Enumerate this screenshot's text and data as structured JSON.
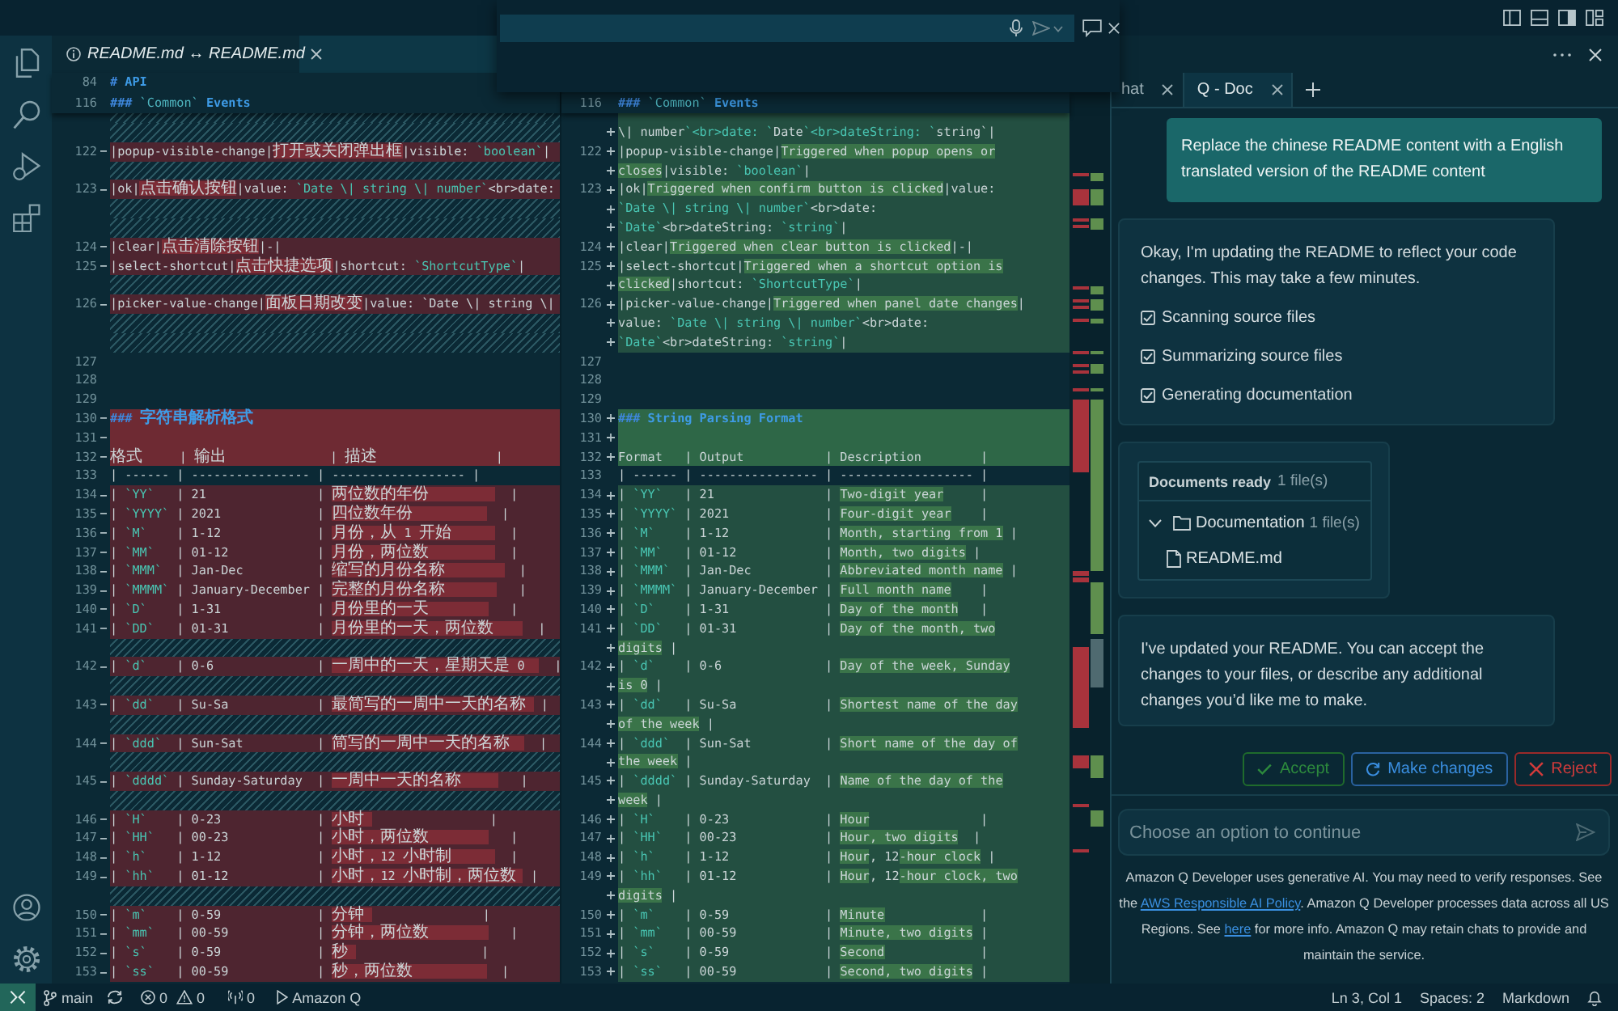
{
  "editor": {
    "tabs": [
      {
        "title": "README.md ↔ README.md",
        "selected": true
      }
    ],
    "left": {
      "sticky": [
        {
          "num": "84",
          "text": "# API"
        },
        {
          "num": "116",
          "text": "### `Common` Events"
        }
      ],
      "rows": [
        {
          "kind": "filler"
        },
        {
          "kind": "removed",
          "num": "122",
          "parts": [
            {
              "text": "|popup-visible-change|",
              "changed": false
            },
            {
              "text": "打开或关闭弹出框",
              "changed": true
            },
            {
              "text": "|visible: `boolean`|",
              "changed": false
            }
          ]
        },
        {
          "kind": "filler"
        },
        {
          "kind": "removed",
          "num": "123",
          "parts": [
            {
              "text": "|ok|",
              "changed": false
            },
            {
              "text": "点击确认按钮",
              "changed": true
            },
            {
              "text": "|value: `Date \\| string \\| number`<br>date:",
              "changed": false
            }
          ]
        },
        {
          "kind": "filler"
        },
        {
          "kind": "filler"
        },
        {
          "kind": "removed",
          "num": "124",
          "parts": [
            {
              "text": "|clear|",
              "changed": false
            },
            {
              "text": "点击清除按钮",
              "changed": true
            },
            {
              "text": "|-|",
              "changed": false
            }
          ]
        },
        {
          "kind": "removed",
          "num": "125",
          "parts": [
            {
              "text": "|select-shortcut|",
              "changed": false
            },
            {
              "text": "点击快捷选项",
              "changed": true
            },
            {
              "text": "|shortcut: `ShortcutType`|",
              "changed": false
            }
          ]
        },
        {
          "kind": "filler"
        },
        {
          "kind": "removed",
          "num": "126",
          "parts": [
            {
              "text": "|picker-value-change|",
              "changed": false
            },
            {
              "text": "面板日期改变",
              "changed": true
            },
            {
              "text": "|value: `Date \\| string \\|",
              "changed": false
            }
          ]
        },
        {
          "kind": "filler"
        },
        {
          "kind": "filler"
        },
        {
          "kind": "context",
          "num": "127"
        },
        {
          "kind": "context",
          "num": "128"
        },
        {
          "kind": "context",
          "num": "129"
        },
        {
          "kind": "removed",
          "num": "130",
          "changed": true,
          "text": "### 字符串解析格式"
        },
        {
          "kind": "removed",
          "num": "131",
          "changed": true
        },
        {
          "kind": "removed",
          "num": "132",
          "changed": true,
          "text": "格式     | 输出              | 描述                |"
        },
        {
          "kind": "context",
          "num": "133",
          "text": "| ------ | ---------------- | ------------------ |"
        },
        {
          "kind": "removed",
          "num": "134",
          "parts": [
            {
              "text": "| `YY`   | 21               | ",
              "changed": false
            },
            {
              "text": "两位数的年份         ",
              "changed": true
            },
            {
              "text": "  |",
              "changed": false
            }
          ]
        },
        {
          "kind": "removed",
          "num": "135",
          "parts": [
            {
              "text": "| `YYYY` | 2021             | ",
              "changed": false
            },
            {
              "text": "四位数年份          ",
              "changed": true
            },
            {
              "text": "  |",
              "changed": false
            }
          ]
        },
        {
          "kind": "removed",
          "num": "136",
          "parts": [
            {
              "text": "| `M`    | 1-12             | ",
              "changed": false
            },
            {
              "text": "月份，从 1 开始      ",
              "changed": true
            },
            {
              "text": "  |",
              "changed": false
            }
          ]
        },
        {
          "kind": "removed",
          "num": "137",
          "parts": [
            {
              "text": "| `MM`   | 01-12            | ",
              "changed": false
            },
            {
              "text": "月份，两位数         ",
              "changed": true
            },
            {
              "text": "  |",
              "changed": false
            }
          ]
        },
        {
          "kind": "removed",
          "num": "138",
          "parts": [
            {
              "text": "| `MMM`  | Jan-Dec          | ",
              "changed": false
            },
            {
              "text": "缩写的月份名称        ",
              "changed": true
            },
            {
              "text": "  |",
              "changed": false
            }
          ]
        },
        {
          "kind": "removed",
          "num": "139",
          "parts": [
            {
              "text": "| `MMMM` | January-December | ",
              "changed": false
            },
            {
              "text": "完整的月份名称       ",
              "changed": true
            },
            {
              "text": "   |",
              "changed": false
            }
          ]
        },
        {
          "kind": "removed",
          "num": "140",
          "parts": [
            {
              "text": "| `D`    | 1-31             | ",
              "changed": false
            },
            {
              "text": "月份里的一天        ",
              "changed": true
            },
            {
              "text": "   |",
              "changed": false
            }
          ]
        },
        {
          "kind": "removed",
          "num": "141",
          "parts": [
            {
              "text": "| `DD`   | 01-31            | ",
              "changed": false
            },
            {
              "text": "月份里的一天，两位数    ",
              "changed": true
            },
            {
              "text": "  |",
              "changed": false
            }
          ]
        },
        {
          "kind": "filler"
        },
        {
          "kind": "removed",
          "num": "142",
          "parts": [
            {
              "text": "| `d`    | 0-6              | ",
              "changed": false
            },
            {
              "text": "一周中的一天，星期天是 0  ",
              "changed": true
            },
            {
              "text": "  |",
              "changed": false
            }
          ]
        },
        {
          "kind": "filler"
        },
        {
          "kind": "removed",
          "num": "143",
          "parts": [
            {
              "text": "| `dd`   | Su-Sa            | ",
              "changed": false
            },
            {
              "text": "最简写的一周中一天的名称 ",
              "changed": true
            },
            {
              "text": " |",
              "changed": false
            }
          ]
        },
        {
          "kind": "filler"
        },
        {
          "kind": "removed",
          "num": "144",
          "parts": [
            {
              "text": "| `ddd`  | Sun-Sat          | ",
              "changed": false
            },
            {
              "text": "简写的一周中一天的名称  ",
              "changed": true
            },
            {
              "text": "  |",
              "changed": false
            }
          ]
        },
        {
          "kind": "filler"
        },
        {
          "kind": "removed",
          "num": "145",
          "parts": [
            {
              "text": "| `dddd` | Sunday-Saturday  | ",
              "changed": false
            },
            {
              "text": "一周中一天的名称     ",
              "changed": true
            },
            {
              "text": "   |",
              "changed": false
            }
          ]
        },
        {
          "kind": "filler"
        },
        {
          "kind": "removed",
          "num": "146",
          "parts": [
            {
              "text": "| `H`    | 0-23             | ",
              "changed": false
            },
            {
              "text": "小时 ",
              "changed": true
            },
            {
              "text": "                |",
              "changed": false
            }
          ]
        },
        {
          "kind": "removed",
          "num": "147",
          "parts": [
            {
              "text": "| `HH`   | 00-23            | ",
              "changed": false
            },
            {
              "text": "小时，两位数        ",
              "changed": true
            },
            {
              "text": "   |",
              "changed": false
            }
          ]
        },
        {
          "kind": "removed",
          "num": "148",
          "parts": [
            {
              "text": "| `h`    | 1-12             | ",
              "changed": false
            },
            {
              "text": "小时，12 小时制      ",
              "changed": true
            },
            {
              "text": "  |",
              "changed": false
            }
          ]
        },
        {
          "kind": "removed",
          "num": "149",
          "parts": [
            {
              "text": "| `hh`   | 01-12            | ",
              "changed": false
            },
            {
              "text": "小时，12 小时制，两位数 ",
              "changed": true
            },
            {
              "text": " |",
              "changed": false
            }
          ]
        },
        {
          "kind": "filler"
        },
        {
          "kind": "removed",
          "num": "150",
          "parts": [
            {
              "text": "| `m`    | 0-59             | ",
              "changed": false
            },
            {
              "text": "分钟 ",
              "changed": true
            },
            {
              "text": "               |",
              "changed": false
            }
          ]
        },
        {
          "kind": "removed",
          "num": "151",
          "parts": [
            {
              "text": "| `mm`   | 00-59            | ",
              "changed": false
            },
            {
              "text": "分钟，两位数        ",
              "changed": true
            },
            {
              "text": "   |",
              "changed": false
            }
          ]
        },
        {
          "kind": "removed",
          "num": "152",
          "parts": [
            {
              "text": "| `s`    | 0-59             | ",
              "changed": false
            },
            {
              "text": "秒 ",
              "changed": true
            },
            {
              "text": "                 |",
              "changed": false
            }
          ]
        },
        {
          "kind": "removed",
          "num": "153",
          "parts": [
            {
              "text": "| `ss`   | 00-59            | ",
              "changed": false
            },
            {
              "text": "秒，两位数          ",
              "changed": true
            },
            {
              "text": "  |",
              "changed": false
            }
          ]
        }
      ]
    },
    "right": {
      "sticky": [
        {
          "num": "116",
          "text": "### `Common` Events"
        }
      ],
      "rows": [
        {
          "kind": "added",
          "text": "\\| number`<br>date: `Date`<br>dateString: `string`|"
        },
        {
          "kind": "added",
          "num": "122",
          "parts": [
            {
              "text": "|popup-visible-change|",
              "changed": false
            },
            {
              "text": "Triggered when popup opens or",
              "changed": true
            }
          ]
        },
        {
          "kind": "added",
          "parts": [
            {
              "text": "closes",
              "changed": true
            },
            {
              "text": "|visible: `boolean`|",
              "changed": false
            }
          ]
        },
        {
          "kind": "added",
          "num": "123",
          "parts": [
            {
              "text": "|ok|",
              "changed": false
            },
            {
              "text": "Triggered when confirm button is clicked",
              "changed": true
            },
            {
              "text": "|value:",
              "changed": false
            }
          ]
        },
        {
          "kind": "added",
          "text": "`Date \\| string \\| number`<br>date:"
        },
        {
          "kind": "added",
          "text": "`Date`<br>dateString: `string`|"
        },
        {
          "kind": "added",
          "num": "124",
          "parts": [
            {
              "text": "|clear|",
              "changed": false
            },
            {
              "text": "Triggered when clear button is clicked",
              "changed": true
            },
            {
              "text": "|-|",
              "changed": false
            }
          ]
        },
        {
          "kind": "added",
          "num": "125",
          "parts": [
            {
              "text": "|select-shortcut|",
              "changed": false
            },
            {
              "text": "Triggered when a shortcut option is",
              "changed": true
            }
          ]
        },
        {
          "kind": "added",
          "parts": [
            {
              "text": "clicked",
              "changed": true
            },
            {
              "text": "|shortcut: `ShortcutType`|",
              "changed": false
            }
          ]
        },
        {
          "kind": "added",
          "num": "126",
          "parts": [
            {
              "text": "|picker-value-change|",
              "changed": false
            },
            {
              "text": "Triggered when panel date changes",
              "changed": true
            },
            {
              "text": "|",
              "changed": false
            }
          ]
        },
        {
          "kind": "added",
          "text": "value: `Date \\| string \\| number`<br>date:"
        },
        {
          "kind": "added",
          "text": "`Date`<br>dateString: `string`|"
        },
        {
          "kind": "context",
          "num": "127"
        },
        {
          "kind": "context",
          "num": "128"
        },
        {
          "kind": "context",
          "num": "129"
        },
        {
          "kind": "added",
          "num": "130",
          "changed": true,
          "text": "### String Parsing Format"
        },
        {
          "kind": "added",
          "num": "131",
          "changed": true
        },
        {
          "kind": "added",
          "num": "132",
          "changed": true,
          "text": "Format   | Output           | Description        |"
        },
        {
          "kind": "context",
          "num": "133",
          "text": "| ------ | ---------------- | ------------------ |"
        },
        {
          "kind": "added",
          "num": "134",
          "parts": [
            {
              "text": "| `YY`   | 21               | ",
              "changed": false
            },
            {
              "text": "Two-digit year",
              "changed": true
            },
            {
              "text": "     |",
              "changed": false
            }
          ]
        },
        {
          "kind": "added",
          "num": "135",
          "parts": [
            {
              "text": "| `YYYY` | 2021             | ",
              "changed": false
            },
            {
              "text": "Four-digit year",
              "changed": true
            },
            {
              "text": "    |",
              "changed": false
            }
          ]
        },
        {
          "kind": "added",
          "num": "136",
          "parts": [
            {
              "text": "| `M`    | 1-12             | ",
              "changed": false
            },
            {
              "text": "Month, starting from 1",
              "changed": true
            },
            {
              "text": " |",
              "changed": false
            }
          ]
        },
        {
          "kind": "added",
          "num": "137",
          "parts": [
            {
              "text": "| `MM`   | 01-12            | ",
              "changed": false
            },
            {
              "text": "Month, two digits",
              "changed": true
            },
            {
              "text": " |",
              "changed": false
            }
          ]
        },
        {
          "kind": "added",
          "num": "138",
          "parts": [
            {
              "text": "| `MMM`  | Jan-Dec          | ",
              "changed": false
            },
            {
              "text": "Abbreviated month name",
              "changed": true
            },
            {
              "text": " |",
              "changed": false
            }
          ]
        },
        {
          "kind": "added",
          "num": "139",
          "parts": [
            {
              "text": "| `MMMM` | January-December | ",
              "changed": false
            },
            {
              "text": "Full month name",
              "changed": true
            },
            {
              "text": "    |",
              "changed": false
            }
          ]
        },
        {
          "kind": "added",
          "num": "140",
          "parts": [
            {
              "text": "| `D`    | 1-31             | ",
              "changed": false
            },
            {
              "text": "Day of the month",
              "changed": true
            },
            {
              "text": "   |",
              "changed": false
            }
          ]
        },
        {
          "kind": "added",
          "num": "141",
          "parts": [
            {
              "text": "| `DD`   | 01-31            | ",
              "changed": false
            },
            {
              "text": "Day of the month, two",
              "changed": true
            }
          ]
        },
        {
          "kind": "added",
          "parts": [
            {
              "text": "digits",
              "changed": true
            },
            {
              "text": " |",
              "changed": false
            }
          ]
        },
        {
          "kind": "added",
          "num": "142",
          "parts": [
            {
              "text": "| `d`    | 0-6              | ",
              "changed": false
            },
            {
              "text": "Day of the week, Sunday",
              "changed": true
            }
          ]
        },
        {
          "kind": "added",
          "parts": [
            {
              "text": "is 0",
              "changed": true
            },
            {
              "text": " |",
              "changed": false
            }
          ]
        },
        {
          "kind": "added",
          "num": "143",
          "parts": [
            {
              "text": "| `dd`   | Su-Sa            | ",
              "changed": false
            },
            {
              "text": "Shortest name of the day",
              "changed": true
            }
          ]
        },
        {
          "kind": "added",
          "parts": [
            {
              "text": "of the week",
              "changed": true
            },
            {
              "text": " |",
              "changed": false
            }
          ]
        },
        {
          "kind": "added",
          "num": "144",
          "parts": [
            {
              "text": "| `ddd`  | Sun-Sat          | ",
              "changed": false
            },
            {
              "text": "Short name of the day of",
              "changed": true
            }
          ]
        },
        {
          "kind": "added",
          "parts": [
            {
              "text": "the week",
              "changed": true
            },
            {
              "text": " |",
              "changed": false
            }
          ]
        },
        {
          "kind": "added",
          "num": "145",
          "parts": [
            {
              "text": "| `dddd` | Sunday-Saturday  | ",
              "changed": false
            },
            {
              "text": "Name of the day of the",
              "changed": true
            }
          ]
        },
        {
          "kind": "added",
          "parts": [
            {
              "text": "week",
              "changed": true
            },
            {
              "text": " |",
              "changed": false
            }
          ]
        },
        {
          "kind": "added",
          "num": "146",
          "parts": [
            {
              "text": "| `H`    | 0-23             | ",
              "changed": false
            },
            {
              "text": "Hour",
              "changed": true
            },
            {
              "text": "               |",
              "changed": false
            }
          ]
        },
        {
          "kind": "added",
          "num": "147",
          "parts": [
            {
              "text": "| `HH`   | 00-23            | ",
              "changed": false
            },
            {
              "text": "Hour, two digits",
              "changed": true
            },
            {
              "text": "  |",
              "changed": false
            }
          ]
        },
        {
          "kind": "added",
          "num": "148",
          "parts": [
            {
              "text": "| `h`    | 1-12             | ",
              "changed": false
            },
            {
              "text": "Hour",
              "changed": true
            },
            {
              "text": ", 12",
              "changed": false
            },
            {
              "text": "-hour clock",
              "changed": true
            },
            {
              "text": " |",
              "changed": false
            }
          ]
        },
        {
          "kind": "added",
          "num": "149",
          "parts": [
            {
              "text": "| `hh`   | 01-12            | ",
              "changed": false
            },
            {
              "text": "Hour",
              "changed": true
            },
            {
              "text": ", 12",
              "changed": false
            },
            {
              "text": "-hour clock, two",
              "changed": true
            }
          ]
        },
        {
          "kind": "added",
          "parts": [
            {
              "text": "digits",
              "changed": true
            },
            {
              "text": " |",
              "changed": false
            }
          ]
        },
        {
          "kind": "added",
          "num": "150",
          "parts": [
            {
              "text": "| `m`    | 0-59             | ",
              "changed": false
            },
            {
              "text": "Minute",
              "changed": true
            },
            {
              "text": "             |",
              "changed": false
            }
          ]
        },
        {
          "kind": "added",
          "num": "151",
          "parts": [
            {
              "text": "| `mm`   | 00-59            | ",
              "changed": false
            },
            {
              "text": "Minute, two digits",
              "changed": true
            },
            {
              "text": " |",
              "changed": false
            }
          ]
        },
        {
          "kind": "added",
          "num": "152",
          "parts": [
            {
              "text": "| `s`    | 0-59             | ",
              "changed": false
            },
            {
              "text": "Second",
              "changed": true
            },
            {
              "text": "             |",
              "changed": false
            }
          ]
        },
        {
          "kind": "added",
          "num": "153",
          "parts": [
            {
              "text": "| `ss`   | 00-59            | ",
              "changed": false
            },
            {
              "text": "Second, two digits",
              "changed": true
            },
            {
              "text": " |",
              "changed": false
            }
          ]
        }
      ]
    }
  },
  "chat": {
    "tabs": [
      {
        "label": "hat",
        "selected": false
      },
      {
        "label": "Q - Doc",
        "selected": true
      }
    ],
    "messages": [
      {
        "kind": "user",
        "text": "Replace the chinese README content with a English translated version of the README content"
      },
      {
        "kind": "assistant",
        "text": "Okay, I'm updating the README to reflect your code changes. This may take a few minutes.",
        "steps": [
          {
            "label": "Scanning source files",
            "checked": true
          },
          {
            "label": "Summarizing source files",
            "checked": true
          },
          {
            "label": "Generating documentation",
            "checked": true
          }
        ]
      },
      {
        "kind": "documents",
        "title": "Documents ready",
        "count": "1 file(s)",
        "tree": [
          {
            "kind": "folder",
            "label": "Documentation",
            "count": "1 file(s)",
            "expanded": true,
            "children": [
              {
                "kind": "file",
                "label": "README.md"
              }
            ]
          }
        ]
      },
      {
        "kind": "assistant",
        "text": "I've updated your README. You can accept the changes to your files, or describe any additional changes you’d like me to make."
      }
    ],
    "actions": [
      {
        "kind": "accept",
        "label": "Accept"
      },
      {
        "kind": "change",
        "label": "Make changes"
      },
      {
        "kind": "reject",
        "label": "Reject"
      }
    ],
    "prompt": {
      "placeholder": "Choose an option to continue"
    },
    "disclaimer": [
      {
        "kind": "text",
        "text": "Amazon Q Developer uses generative AI. You may need to verify responses. See the "
      },
      {
        "kind": "link",
        "text": "AWS Responsible AI Policy"
      },
      {
        "kind": "text",
        "text": ". Amazon Q Developer processes data across all US Regions. See "
      },
      {
        "kind": "link",
        "text": "here"
      },
      {
        "kind": "text",
        "text": " for more info. Amazon Q may retain chats to provide and maintain the service."
      }
    ]
  },
  "status_bar": {
    "branch": "main",
    "errors": "0",
    "warnings": "0",
    "ports": "0",
    "extension": "Amazon Q",
    "items": [
      "Ln 3, Col 1",
      "Spaces: 2",
      "Markdown"
    ]
  }
}
